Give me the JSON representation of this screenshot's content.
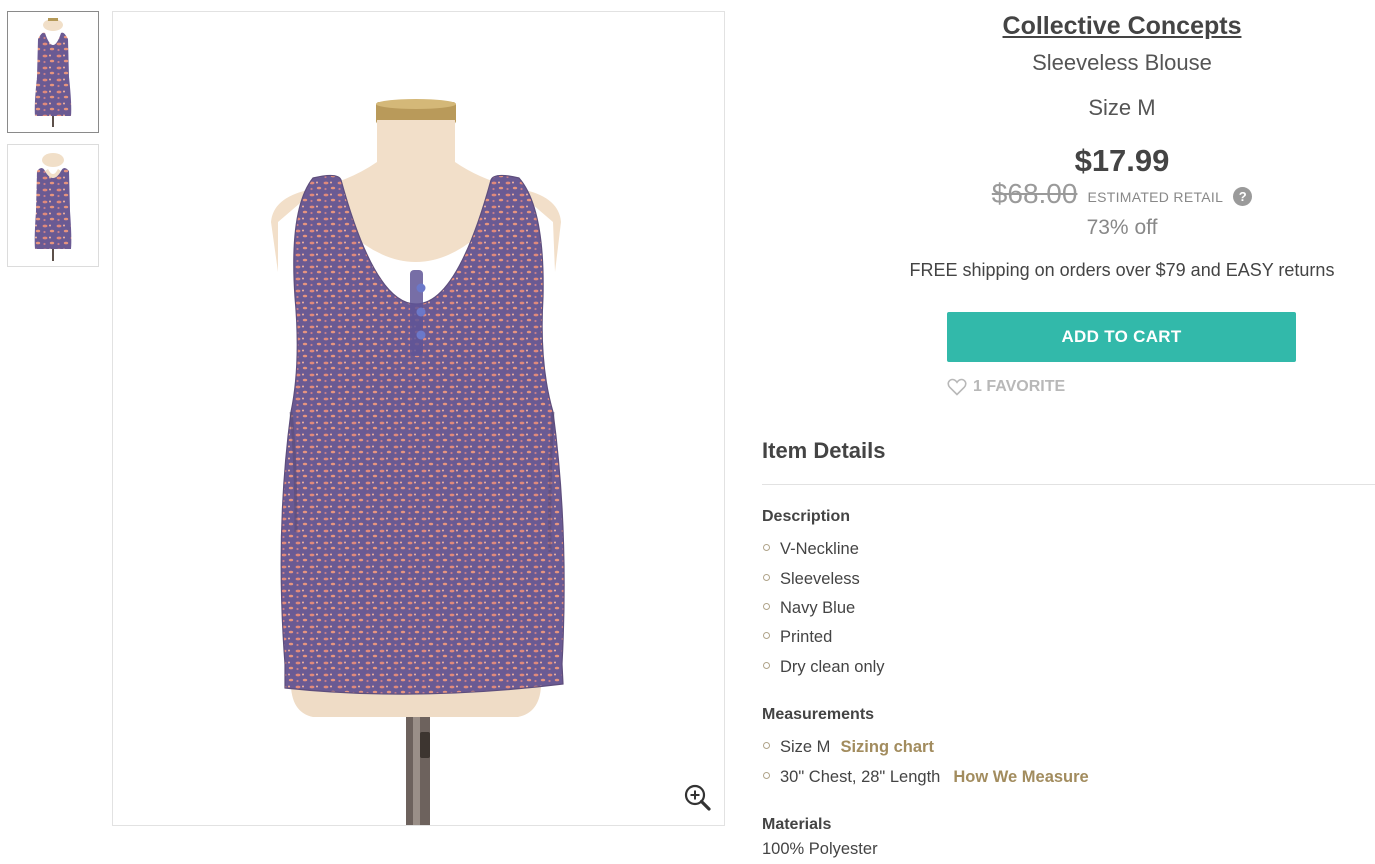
{
  "product": {
    "brand": "Collective Concepts",
    "type": "Sleeveless Blouse",
    "size": "Size M",
    "price": "$17.99",
    "retail_price": "$68.00",
    "retail_label": "ESTIMATED RETAIL",
    "help_glyph": "?",
    "discount": "73% off",
    "shipping": "FREE shipping on orders over $79 and EASY returns"
  },
  "actions": {
    "add_to_cart": "ADD TO CART",
    "favorites": "1 FAVORITE"
  },
  "details": {
    "title": "Item Details",
    "description_label": "Description",
    "description_items": [
      "V-Neckline",
      "Sleeveless",
      "Navy Blue",
      "Printed",
      "Dry clean only"
    ],
    "measurements_label": "Measurements",
    "measurements": [
      {
        "text": "Size M",
        "link": "Sizing chart"
      },
      {
        "text": "30\" Chest, 28\" Length",
        "link": "How We Measure"
      }
    ],
    "materials_label": "Materials",
    "materials_value": "100% Polyester"
  },
  "gallery": {
    "thumbnails": [
      "front-view",
      "back-view"
    ],
    "zoom_icon": "zoom-in-icon"
  },
  "colors": {
    "accent": "#32b9aa",
    "link": "#a28c5e",
    "garment": "#7a5a86"
  }
}
